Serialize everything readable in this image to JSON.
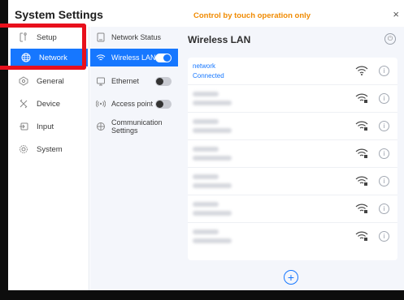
{
  "app": {
    "title": "System Settings",
    "touch_note": "Control by touch operation only",
    "close_symbol": "×"
  },
  "sidebar": {
    "items": [
      {
        "label": "Setup",
        "icon": "setup-icon",
        "active": false
      },
      {
        "label": "Network",
        "icon": "network-globe-icon",
        "active": true
      },
      {
        "label": "General",
        "icon": "general-icon",
        "active": false
      },
      {
        "label": "Device",
        "icon": "device-icon",
        "active": false
      },
      {
        "label": "Input",
        "icon": "input-icon",
        "active": false
      },
      {
        "label": "System",
        "icon": "system-gear-icon",
        "active": false
      }
    ]
  },
  "subnav": {
    "items": [
      {
        "label": "Network Status",
        "icon": "network-status-icon"
      },
      {
        "label": "Wireless LAN",
        "icon": "wifi-icon",
        "toggle": "on"
      },
      {
        "label": "Ethernet",
        "icon": "ethernet-icon",
        "toggle": "off"
      },
      {
        "label": "Access point",
        "icon": "access-point-icon",
        "toggle": "off"
      },
      {
        "label_line1": "Communication",
        "label_line2": "Settings",
        "icon": "communication-icon"
      }
    ]
  },
  "main": {
    "title": "Wireless LAN",
    "networks": [
      {
        "name": "network",
        "status": "Connected"
      }
    ],
    "hidden_network_rows": 7,
    "add_symbol": "+"
  },
  "colors": {
    "accent": "#1677ff",
    "warning": "#f08a00",
    "annotation": "#e8101c"
  }
}
